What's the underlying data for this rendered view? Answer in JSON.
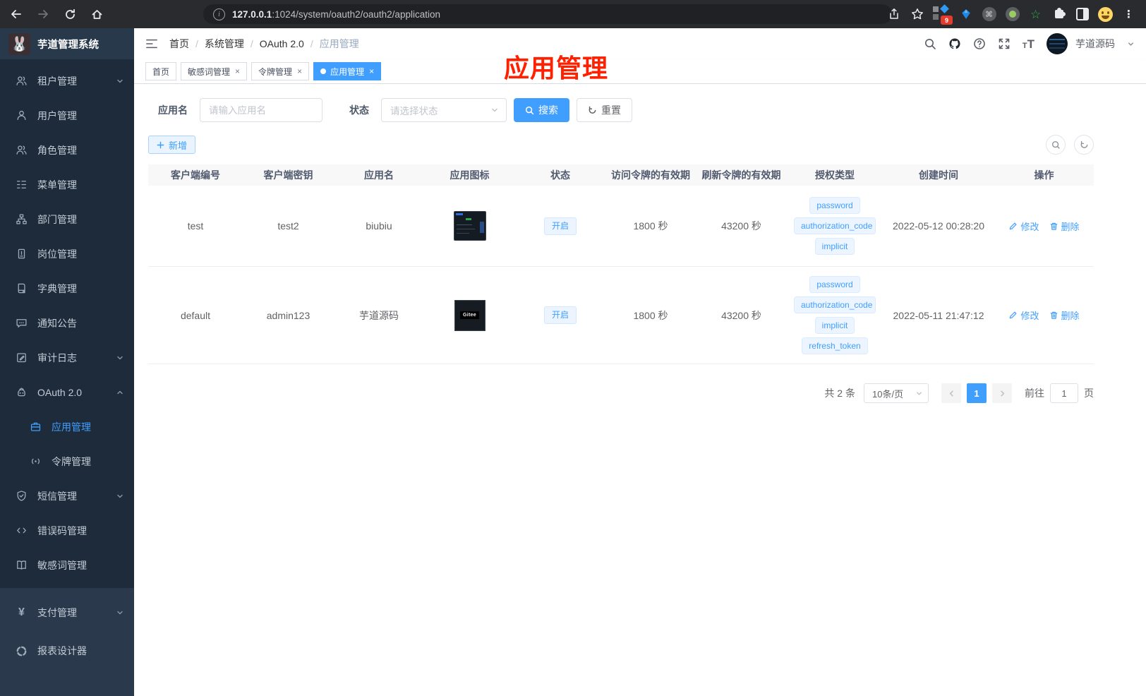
{
  "colors": {
    "accent": "#409eff",
    "annotation_red": "#ff2000",
    "sidebar_bg": "#1d2b3a"
  },
  "browser": {
    "url_host": "127.0.0.1",
    "url_path": ":1024/system/oauth2/oauth2/application",
    "extension_badge": "9"
  },
  "sidebar": {
    "title": "芋道管理系统",
    "items": [
      {
        "label": "租户管理"
      },
      {
        "label": "用户管理"
      },
      {
        "label": "角色管理"
      },
      {
        "label": "菜单管理"
      },
      {
        "label": "部门管理"
      },
      {
        "label": "岗位管理"
      },
      {
        "label": "字典管理"
      },
      {
        "label": "通知公告"
      },
      {
        "label": "审计日志"
      },
      {
        "label": "OAuth 2.0"
      },
      {
        "label": "应用管理"
      },
      {
        "label": "令牌管理"
      },
      {
        "label": "短信管理"
      },
      {
        "label": "错误码管理"
      },
      {
        "label": "敏感词管理"
      },
      {
        "label": "支付管理"
      },
      {
        "label": "报表设计器"
      }
    ]
  },
  "header": {
    "breadcrumb": [
      "首页",
      "系统管理",
      "OAuth 2.0",
      "应用管理"
    ],
    "username": "芋道源码"
  },
  "annotation": {
    "text": "应用管理"
  },
  "tabs": [
    {
      "label": "首页"
    },
    {
      "label": "敏感词管理"
    },
    {
      "label": "令牌管理"
    },
    {
      "label": "应用管理"
    }
  ],
  "filters": {
    "name_label": "应用名",
    "name_placeholder": "请输入应用名",
    "status_label": "状态",
    "status_placeholder": "请选择状态",
    "search_label": "搜索",
    "reset_label": "重置"
  },
  "toolbar": {
    "add_label": "新增"
  },
  "table": {
    "columns": [
      "客户端编号",
      "客户端密钥",
      "应用名",
      "应用图标",
      "状态",
      "访问令牌的有效期",
      "刷新令牌的有效期",
      "授权类型",
      "创建时间",
      "操作"
    ],
    "rows": [
      {
        "client_id": "test",
        "secret": "test2",
        "name": "biubiu",
        "status": "开启",
        "access_validity": "1800 秒",
        "refresh_validity": "43200 秒",
        "grant_types": [
          "password",
          "authorization_code",
          "implicit"
        ],
        "created": "2022-05-12 00:28:20",
        "edit_label": "修改",
        "delete_label": "删除"
      },
      {
        "client_id": "default",
        "secret": "admin123",
        "name": "芋道源码",
        "icon_text": "Gitee",
        "status": "开启",
        "access_validity": "1800 秒",
        "refresh_validity": "43200 秒",
        "grant_types": [
          "password",
          "authorization_code",
          "implicit",
          "refresh_token"
        ],
        "created": "2022-05-11 21:47:12",
        "edit_label": "修改",
        "delete_label": "删除"
      }
    ]
  },
  "pagination": {
    "total": "共 2 条",
    "page_size": "10条/页",
    "current_page": "1",
    "goto_label": "前往",
    "goto_value": "1",
    "page_unit": "页"
  }
}
